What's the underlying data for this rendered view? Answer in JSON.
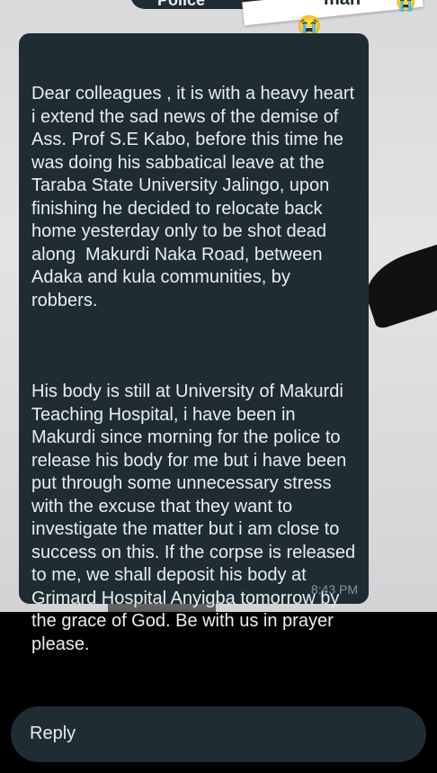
{
  "top_overlay": {
    "pill_text": "Police",
    "sticker_text": "man",
    "emoji_center": "😭",
    "emoji_right": "😭"
  },
  "message": {
    "paragraphs": [
      "Dear colleagues , it is with a heavy heart i extend the sad news of the demise of Ass. Prof S.E Kabo, before this time he was doing his sabbatical leave at the Taraba State University Jalingo, upon finishing he decided to relocate back home yesterday only to be shot dead along  Makurdi Naka Road, between Adaka and kula communities, by robbers.",
      "His body is still at University of Makurdi Teaching Hospital, i have been in Makurdi since morning for the police to release his body for me but i have been put through some unnecessary stress with the excuse that they want to investigate the matter but i am close to success on this. If the corpse is released to me, we shall deposit his body at Grimard Hospital Anyigba tomorrow by the grace of God. Be with us in prayer please."
    ],
    "time": "8:43 PM"
  },
  "reply": {
    "label": "Reply"
  },
  "colors": {
    "bubble": "#202c33",
    "text": "#e9edef",
    "timestamp": "#8696a0",
    "background": "#000000"
  }
}
